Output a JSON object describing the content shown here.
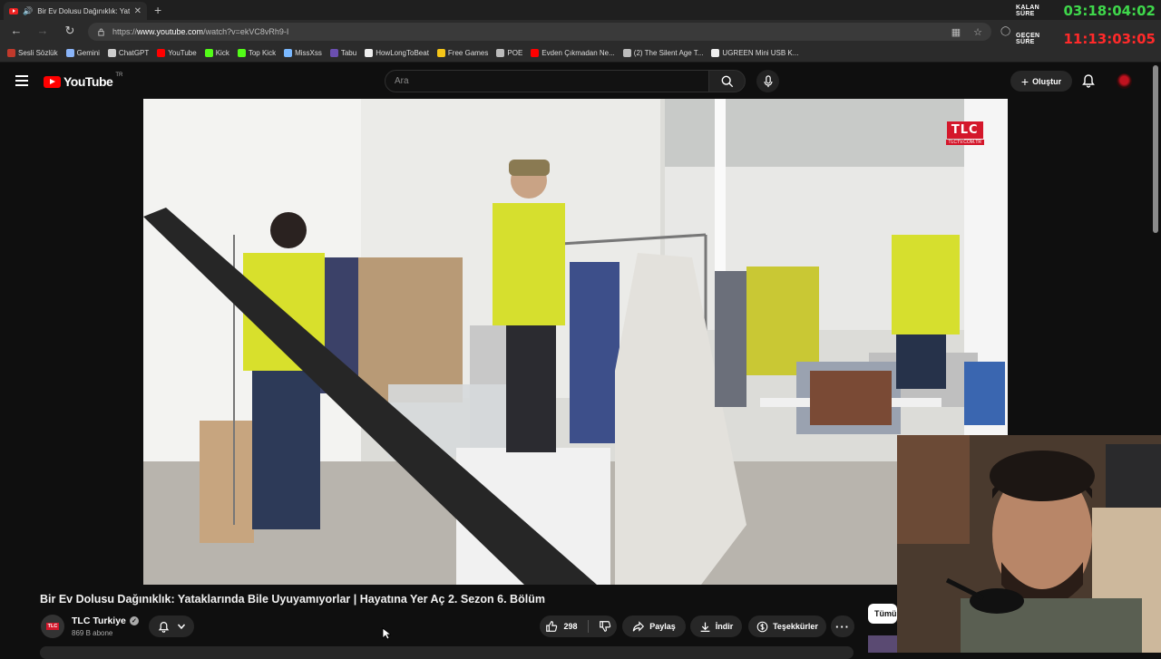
{
  "browser": {
    "tab_title": "Bir Ev Dolusu Dağınıklık: Yat",
    "url_prefix": "https://",
    "url_host": "www.youtube.com",
    "url_path": "/watch?v=ekVC8vRh9-I",
    "bookmarks": [
      {
        "label": "Sesli Sözlük",
        "icon": "flag-icon",
        "color": "#c0392b"
      },
      {
        "label": "Gemini",
        "icon": "sparkle-icon",
        "color": "#8ab4f8"
      },
      {
        "label": "ChatGPT",
        "icon": "openai-icon",
        "color": "#cccccc"
      },
      {
        "label": "YouTube",
        "icon": "youtube-icon",
        "color": "#ff0000"
      },
      {
        "label": "Kick",
        "icon": "kick-icon",
        "color": "#53fc18"
      },
      {
        "label": "Top Kick",
        "icon": "kick-icon",
        "color": "#53fc18"
      },
      {
        "label": "MissXss",
        "icon": "star-icon",
        "color": "#7ab8ff"
      },
      {
        "label": "Tabu",
        "icon": "tabu-icon",
        "color": "#6b4fb0"
      },
      {
        "label": "HowLongToBeat",
        "icon": "hltb-icon",
        "color": "#eeeeee"
      },
      {
        "label": "Free Games",
        "icon": "tag-icon",
        "color": "#f5c518"
      },
      {
        "label": "POE",
        "icon": "folder-icon",
        "color": "#bbbbbb"
      },
      {
        "label": "Evden Çıkmadan Ne...",
        "icon": "youtube-icon",
        "color": "#ff0000"
      },
      {
        "label": "(2) The Silent Age T...",
        "icon": "globe-icon",
        "color": "#bbbbbb"
      },
      {
        "label": "UGREEN Mini USB K...",
        "icon": "amazon-icon",
        "color": "#eeeeee"
      }
    ]
  },
  "timer": {
    "remaining_label": "KALAN SÜRE",
    "remaining_value": "03:18:04:02",
    "elapsed_label": "GEÇEN SÜRE",
    "elapsed_value": "11:13:03:05"
  },
  "youtube": {
    "logo_text": "YouTube",
    "region": "TR",
    "search_placeholder": "Ara",
    "create_label": "Oluştur"
  },
  "video": {
    "watermark": "TLC",
    "watermark_sub": "TLCTV.COM.TR",
    "title": "Bir Ev Dolusu Dağınıklık: Yataklarında Bile Uyuyamıyorlar | Hayatına Yer Aç 2. Sezon 6. Bölüm",
    "channel_avatar_text": "TLC",
    "channel_name": "TLC Turkiye",
    "subscribers": "869 B abone",
    "likes": "298",
    "share_label": "Paylaş",
    "download_label": "İndir",
    "thanks_label": "Teşekkürler",
    "sidebar_chip": "Tümü"
  }
}
